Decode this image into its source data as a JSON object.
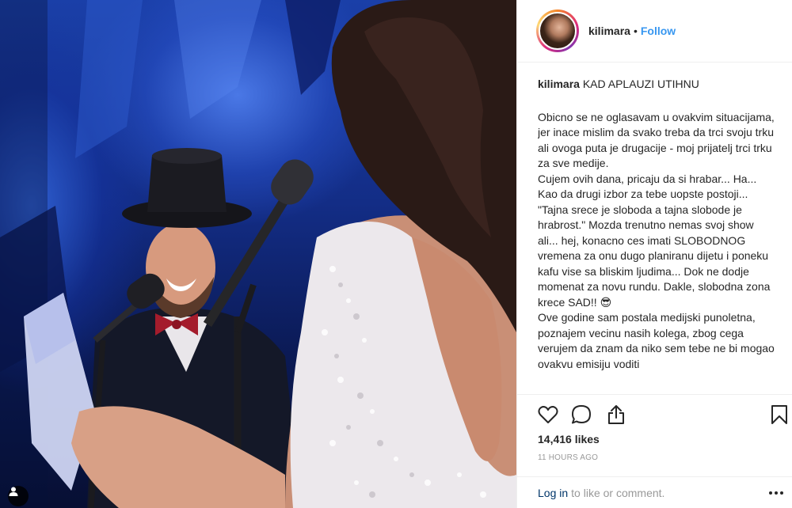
{
  "header": {
    "username": "kilimara",
    "separator": "•",
    "follow_label": "Follow"
  },
  "caption": {
    "username": "kilimara",
    "title": "KAD APLAUZI UTIHNU",
    "paragraphs": [
      "Obicno se ne oglasavam u ovakvim situacijama, jer inace mislim da svako treba da trci svoju trku ali ovoga puta je drugacije - moj prijatelj trci trku za sve medije.",
      "Cujem ovih dana, pricaju da si hrabar... Ha... Kao da drugi izbor za tebe uopste postoji... \"Tajna srece je sloboda a tajna slobode je hrabrost.\" Mozda trenutno nemas svoj show ali... hej, konacno ces imati SLOBODNOG vremena za onu dugo planiranu dijetu i poneku kafu vise sa bliskim ljudima... Dok ne dodje momenat za novu rundu. Dakle, slobodna zona krece SAD!! 😎",
      "Ove godine sam postala medijski punoletna, poznajem vecinu nasih kolega, zbog cega verujem da znam da niko sem tebe ne bi mogao ovakvu emisiju voditi"
    ]
  },
  "actions": {
    "like_icon": "heart-icon",
    "comment_icon": "comment-icon",
    "share_icon": "share-icon",
    "save_icon": "bookmark-icon"
  },
  "stats": {
    "likes": "14,416 likes",
    "timestamp": "11 HOURS AGO"
  },
  "comment_bar": {
    "login_label": "Log in",
    "prompt": "to like or comment."
  },
  "colors": {
    "follow": "#3897f0",
    "link": "#003569",
    "muted": "#999999",
    "stage_blue": "#1a3fa8"
  }
}
